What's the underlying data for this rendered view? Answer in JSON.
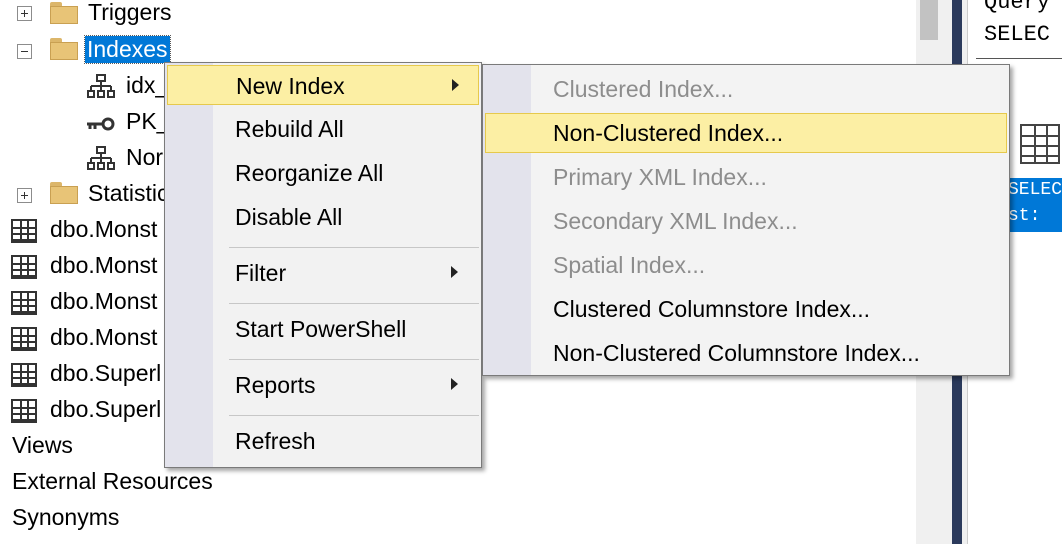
{
  "tree": {
    "items": [
      {
        "label": "Triggers",
        "type": "folder",
        "expander": "plus"
      },
      {
        "label": "Indexes",
        "type": "folder",
        "expander": "minus",
        "selected": true
      },
      {
        "label": "idx_",
        "type": "index"
      },
      {
        "label": "PK_",
        "type": "key"
      },
      {
        "label": "Nor",
        "type": "index"
      },
      {
        "label": "Statistic",
        "type": "folder",
        "expander": "plus"
      },
      {
        "label": "dbo.Monst",
        "type": "table"
      },
      {
        "label": "dbo.Monst",
        "type": "table"
      },
      {
        "label": "dbo.Monst",
        "type": "table"
      },
      {
        "label": "dbo.Monst",
        "type": "table"
      },
      {
        "label": "dbo.Superl",
        "type": "table"
      },
      {
        "label": "dbo.Superl",
        "type": "table"
      },
      {
        "label": "Views",
        "type": "node"
      },
      {
        "label": "External Resources",
        "type": "node"
      },
      {
        "label": "Synonyms",
        "type": "node"
      }
    ]
  },
  "context_menu": {
    "items": [
      {
        "label": "New Index",
        "submenu": true,
        "highlighted": true
      },
      {
        "label": "Rebuild All"
      },
      {
        "label": "Reorganize All"
      },
      {
        "label": "Disable All"
      },
      {
        "label": "Filter",
        "submenu": true
      },
      {
        "label": "Start PowerShell"
      },
      {
        "label": "Reports",
        "submenu": true
      },
      {
        "label": "Refresh"
      }
    ]
  },
  "submenu_new_index": {
    "items": [
      {
        "label": "Clustered Index...",
        "enabled": false
      },
      {
        "label": "Non-Clustered Index...",
        "enabled": true,
        "highlighted": true
      },
      {
        "label": "Primary XML Index...",
        "enabled": false
      },
      {
        "label": "Secondary XML Index...",
        "enabled": false
      },
      {
        "label": "Spatial Index...",
        "enabled": false
      },
      {
        "label": "Clustered Columnstore Index...",
        "enabled": true
      },
      {
        "label": "Non-Clustered Columnstore Index...",
        "enabled": true
      }
    ]
  },
  "editor": {
    "line1": "Query",
    "line2": "SELEC",
    "sel_line1": "SELEC",
    "sel_line2": "st:"
  },
  "colors": {
    "selection": "#0078d7",
    "menu_highlight": "#fcefa4",
    "menu_highlight_border": "#e6c94c",
    "disabled_text": "#8d8d8d"
  }
}
